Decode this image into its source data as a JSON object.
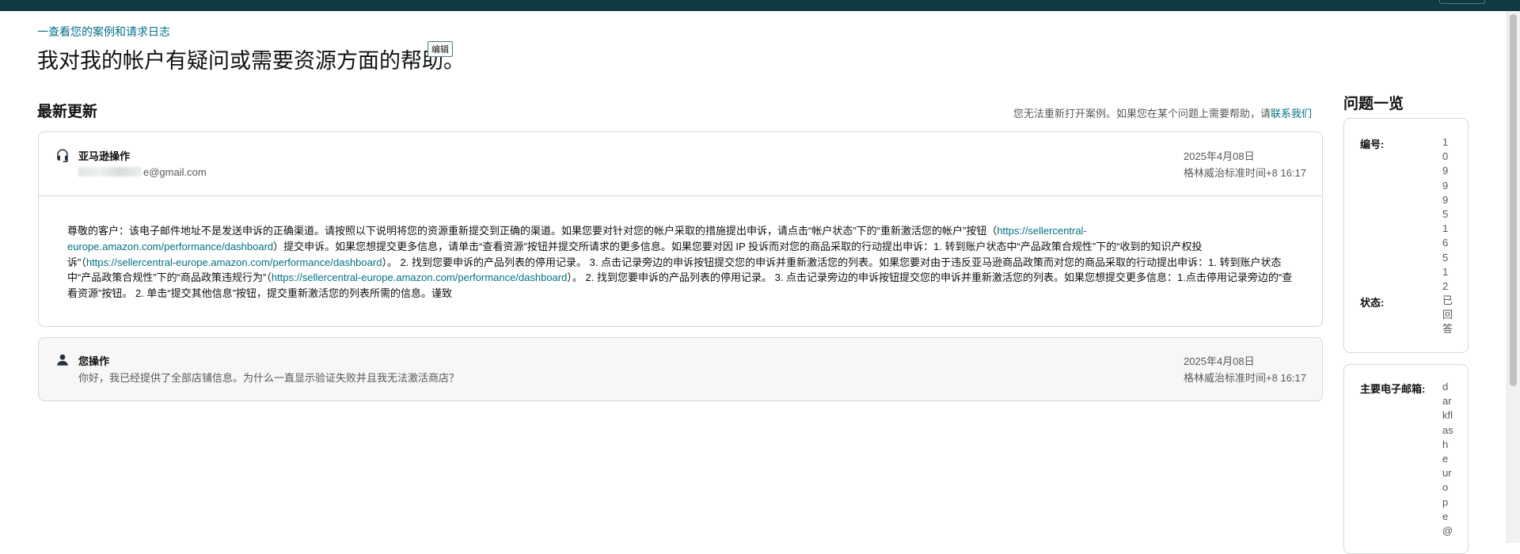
{
  "header": {
    "back_link": "一查看您的案例和请求日志",
    "title": "我对我的帐户有疑问或需要资源方面的帮助。",
    "edit_label": "编辑"
  },
  "updates": {
    "title": "最新更新",
    "reopen_note": "您无法重新打开案例。如果您在某个问题上需要帮助，请",
    "contact_link": "联系我们"
  },
  "messages": [
    {
      "sender": "亚马逊操作",
      "icon": "headset-icon",
      "email_suffix": "e@gmail.com",
      "date": "2025年4月08日",
      "time": "格林威治标准时间+8 16:17",
      "body": [
        {
          "t": "尊敬的客户：该电子邮件地址不是发送申诉的正确渠道。请按照以下说明将您的资源重新提交到正确的渠道。如果您要对针对您的帐户采取的措施提出申诉，请点击“帐户状态”下的“重新激活您的帐户”按钮（"
        },
        {
          "link": "https://sellercentral-europe.amazon.com/performance/dashboard"
        },
        {
          "t": "）提交申诉。如果您想提交更多信息，请单击“查看资源”按钮并提交所请求的更多信息。如果您要对因 IP 投诉而对您的商品采取的行动提出申诉：1. 转到账户状态中“产品政策合规性”下的“收到的知识产权投诉”（"
        },
        {
          "link": "https://sellercentral-europe.amazon.com/performance/dashboard"
        },
        {
          "t": "）。 2. 找到您要申诉的产品列表的停用记录。 3. 点击记录旁边的申诉按钮提交您的申诉并重新激活您的列表。如果您要对由于违反亚马逊商品政策而对您的商品采取的行动提出申诉：1. 转到账户状态中“产品政策合规性”下的“商品政策违规行为”（"
        },
        {
          "link": "https://sellercentral-europe.amazon.com/performance/dashboard"
        },
        {
          "t": "）。 2. 找到您要申诉的产品列表的停用记录。 3. 点击记录旁边的申诉按钮提交您的申诉并重新激活您的列表。如果您想提交更多信息：1.点击停用记录旁边的“查看资源”按钮。 2. 单击“提交其他信息”按钮，提交重新激活您的列表所需的信息。谨致"
        }
      ]
    },
    {
      "sender": "您操作",
      "icon": "user-icon",
      "text": "你好，我已经提供了全部店铺信息。为什么一直显示验证失败并且我无法激活商店？",
      "date": "2025年4月08日",
      "time": "格林威治标准时间+8 16:17"
    }
  ],
  "sidebar": {
    "title": "问题一览",
    "case_id_label": "编号:",
    "case_id": "10999516512",
    "status_label": "状态:",
    "status": "已回答",
    "email_label": "主要电子邮箱:",
    "email_visible": "darkflasheurope@"
  },
  "colors": {
    "topbar": "#0f3a3f",
    "link": "#007185",
    "border": "#d5d9d9",
    "muted_text": "#565959"
  }
}
